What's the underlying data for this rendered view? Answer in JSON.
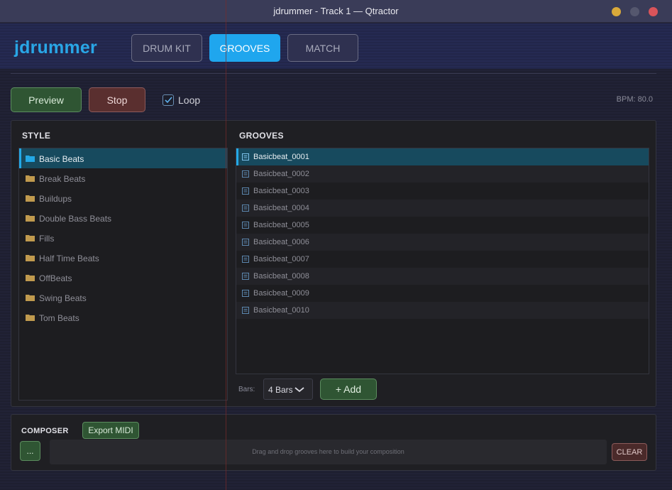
{
  "window": {
    "title": "jdrummer - Track 1 — Qtractor",
    "controls": [
      {
        "name": "minimize",
        "color": "#d9a93a"
      },
      {
        "name": "maximize",
        "color": "#55576e"
      },
      {
        "name": "close",
        "color": "#d9545a"
      }
    ]
  },
  "header": {
    "app_name": "jdrummer",
    "tabs": [
      {
        "label": "DRUM KIT",
        "active": false
      },
      {
        "label": "GROOVES",
        "active": true
      },
      {
        "label": "MATCH",
        "active": false
      }
    ]
  },
  "transport": {
    "preview_label": "Preview",
    "stop_label": "Stop",
    "loop_label": "Loop",
    "loop_checked": true,
    "bpm_text": "BPM: 80.0"
  },
  "style": {
    "heading": "STYLE",
    "items": [
      {
        "label": "Basic Beats",
        "selected": true
      },
      {
        "label": "Break Beats",
        "selected": false
      },
      {
        "label": "Buildups",
        "selected": false
      },
      {
        "label": "Double Bass Beats",
        "selected": false
      },
      {
        "label": "Fills",
        "selected": false
      },
      {
        "label": "Half Time Beats",
        "selected": false
      },
      {
        "label": "OffBeats",
        "selected": false
      },
      {
        "label": "Swing Beats",
        "selected": false
      },
      {
        "label": "Tom Beats",
        "selected": false
      }
    ]
  },
  "grooves": {
    "heading": "GROOVES",
    "items": [
      {
        "label": "Basicbeat_0001",
        "selected": true
      },
      {
        "label": "Basicbeat_0002",
        "selected": false
      },
      {
        "label": "Basicbeat_0003",
        "selected": false
      },
      {
        "label": "Basicbeat_0004",
        "selected": false
      },
      {
        "label": "Basicbeat_0005",
        "selected": false
      },
      {
        "label": "Basicbeat_0006",
        "selected": false
      },
      {
        "label": "Basicbeat_0007",
        "selected": false
      },
      {
        "label": "Basicbeat_0008",
        "selected": false
      },
      {
        "label": "Basicbeat_0009",
        "selected": false
      },
      {
        "label": "Basicbeat_0010",
        "selected": false
      }
    ],
    "bars_label": "Bars:",
    "bars_value": "4 Bars",
    "add_label": "+ Add"
  },
  "composer": {
    "heading": "COMPOSER",
    "export_label": "Export MIDI",
    "more_label": "...",
    "dropzone_text": "Drag and drop grooves here to build your composition",
    "clear_label": "CLEAR"
  },
  "icons": {
    "folder": "folder-icon",
    "groove": "document-icon",
    "checkbox": "check-icon",
    "dropdown": "chevron-down-icon"
  },
  "colors": {
    "accent": "#24a8e6",
    "folder": "#c09a4e",
    "folder_selected": "#24a8e6",
    "doc_icon": "#5c88b0",
    "doc_icon_selected": "#7fc4ee"
  }
}
